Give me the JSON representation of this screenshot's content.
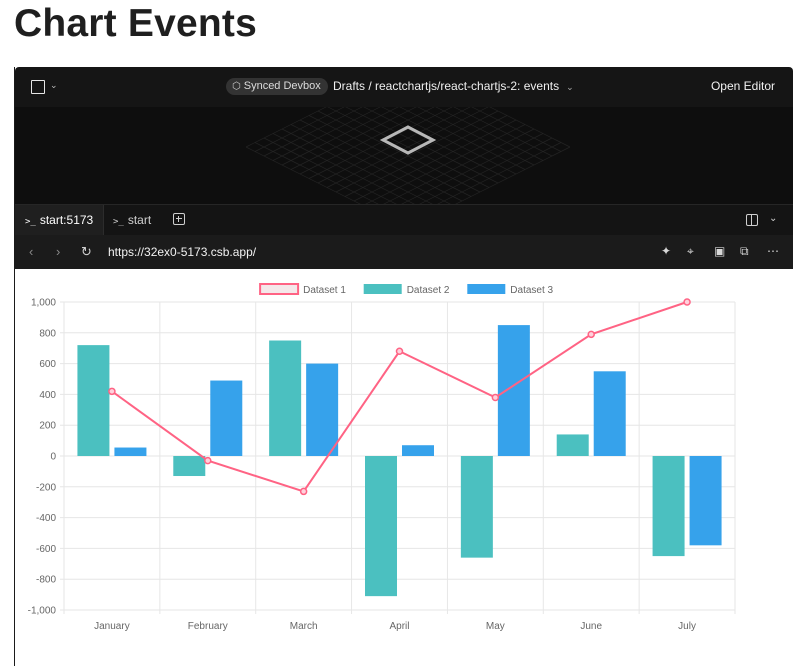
{
  "page": {
    "title": "Chart Events"
  },
  "topbar": {
    "badge": "Synced Devbox",
    "breadcrumb": "Drafts / reactchartjs/react-chartjs-2: events",
    "open_editor": "Open Editor"
  },
  "tabs": [
    {
      "label": "start:5173",
      "active": true
    },
    {
      "label": "start",
      "active": false
    }
  ],
  "browser": {
    "url": "https://32ex0-5173.csb.app/"
  },
  "chart_data": {
    "type": "bar",
    "categories": [
      "January",
      "February",
      "March",
      "April",
      "May",
      "June",
      "July"
    ],
    "ylim": [
      -1000,
      1000
    ],
    "yticks": [
      1000,
      800,
      600,
      400,
      200,
      0,
      -200,
      -400,
      -600,
      -800,
      -1000
    ],
    "ytick_labels": [
      "1,000",
      "800",
      "600",
      "400",
      "200",
      "0",
      "-200",
      "-400",
      "-600",
      "-800",
      "-1,000"
    ],
    "grid": true,
    "legend_position": "top",
    "series": [
      {
        "name": "Dataset 1",
        "type": "line",
        "color": "#ff6384",
        "values": [
          420,
          -30,
          -230,
          680,
          380,
          790,
          1000
        ]
      },
      {
        "name": "Dataset 2",
        "type": "bar",
        "color": "#4bc0c0",
        "values": [
          720,
          -130,
          750,
          -910,
          -660,
          140,
          -650
        ]
      },
      {
        "name": "Dataset 3",
        "type": "bar",
        "color": "#36a2eb",
        "values": [
          55,
          490,
          600,
          70,
          850,
          550,
          -580
        ]
      }
    ]
  }
}
